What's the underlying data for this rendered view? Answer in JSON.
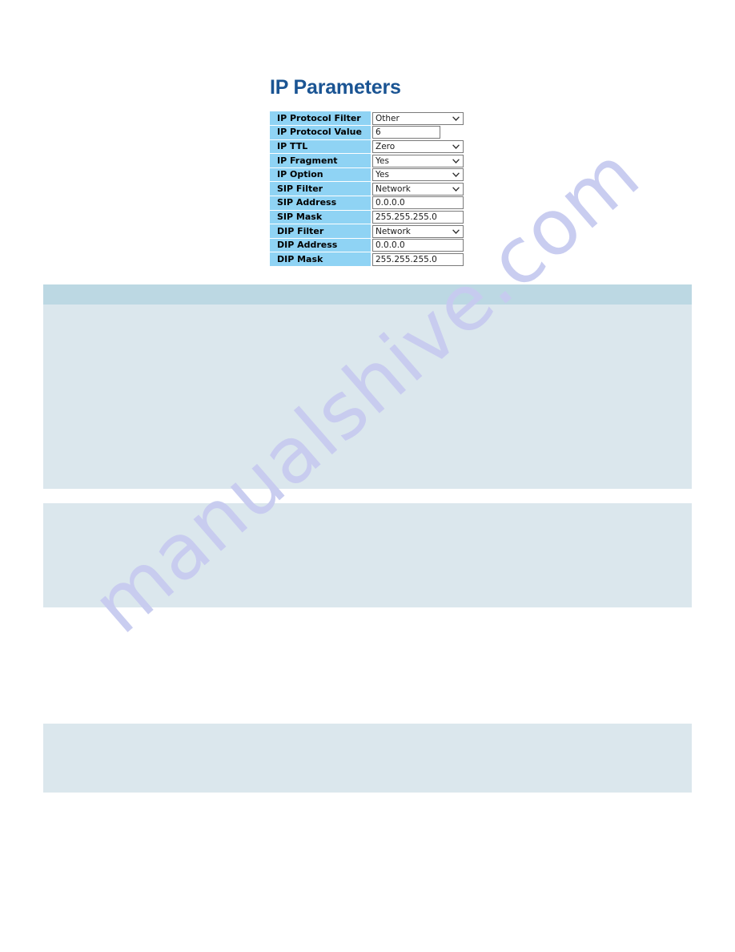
{
  "page": {
    "title": "IP Parameters",
    "title_color": "#1a5493",
    "background_color": "#ffffff"
  },
  "watermark": {
    "text": "manualshive.com",
    "color": "#c7cbf0",
    "rotation_deg": -41
  },
  "parameters_form": {
    "label_background": "#8fd3f4",
    "rows": [
      {
        "label": "IP Protocol Filter",
        "control": "select",
        "value": "Other",
        "width": "wide"
      },
      {
        "label": "IP Protocol Value",
        "control": "text",
        "value": "6",
        "width": "narrow"
      },
      {
        "label": "IP TTL",
        "control": "select",
        "value": "Zero",
        "width": "wide"
      },
      {
        "label": "IP Fragment",
        "control": "select",
        "value": "Yes",
        "width": "wide"
      },
      {
        "label": "IP Option",
        "control": "select",
        "value": "Yes",
        "width": "wide"
      },
      {
        "label": "SIP Filter",
        "control": "select",
        "value": "Network",
        "width": "wide"
      },
      {
        "label": "SIP Address",
        "control": "text",
        "value": "0.0.0.0",
        "width": "wide"
      },
      {
        "label": "SIP Mask",
        "control": "text",
        "value": "255.255.255.0",
        "width": "wide"
      },
      {
        "label": "DIP Filter",
        "control": "select",
        "value": "Network",
        "width": "wide"
      },
      {
        "label": "DIP Address",
        "control": "text",
        "value": "0.0.0.0",
        "width": "wide"
      },
      {
        "label": "DIP Mask",
        "control": "text",
        "value": "255.255.255.0",
        "width": "wide"
      }
    ]
  },
  "content_blocks": [
    {
      "has_header": true,
      "header_color": "#bcd8e3",
      "body_color": "#dbe7ed"
    },
    {
      "has_header": false,
      "header_color": "#bcd8e3",
      "body_color": "#dbe7ed"
    },
    {
      "has_header": false,
      "header_color": "#bcd8e3",
      "body_color": "#dbe7ed"
    }
  ]
}
